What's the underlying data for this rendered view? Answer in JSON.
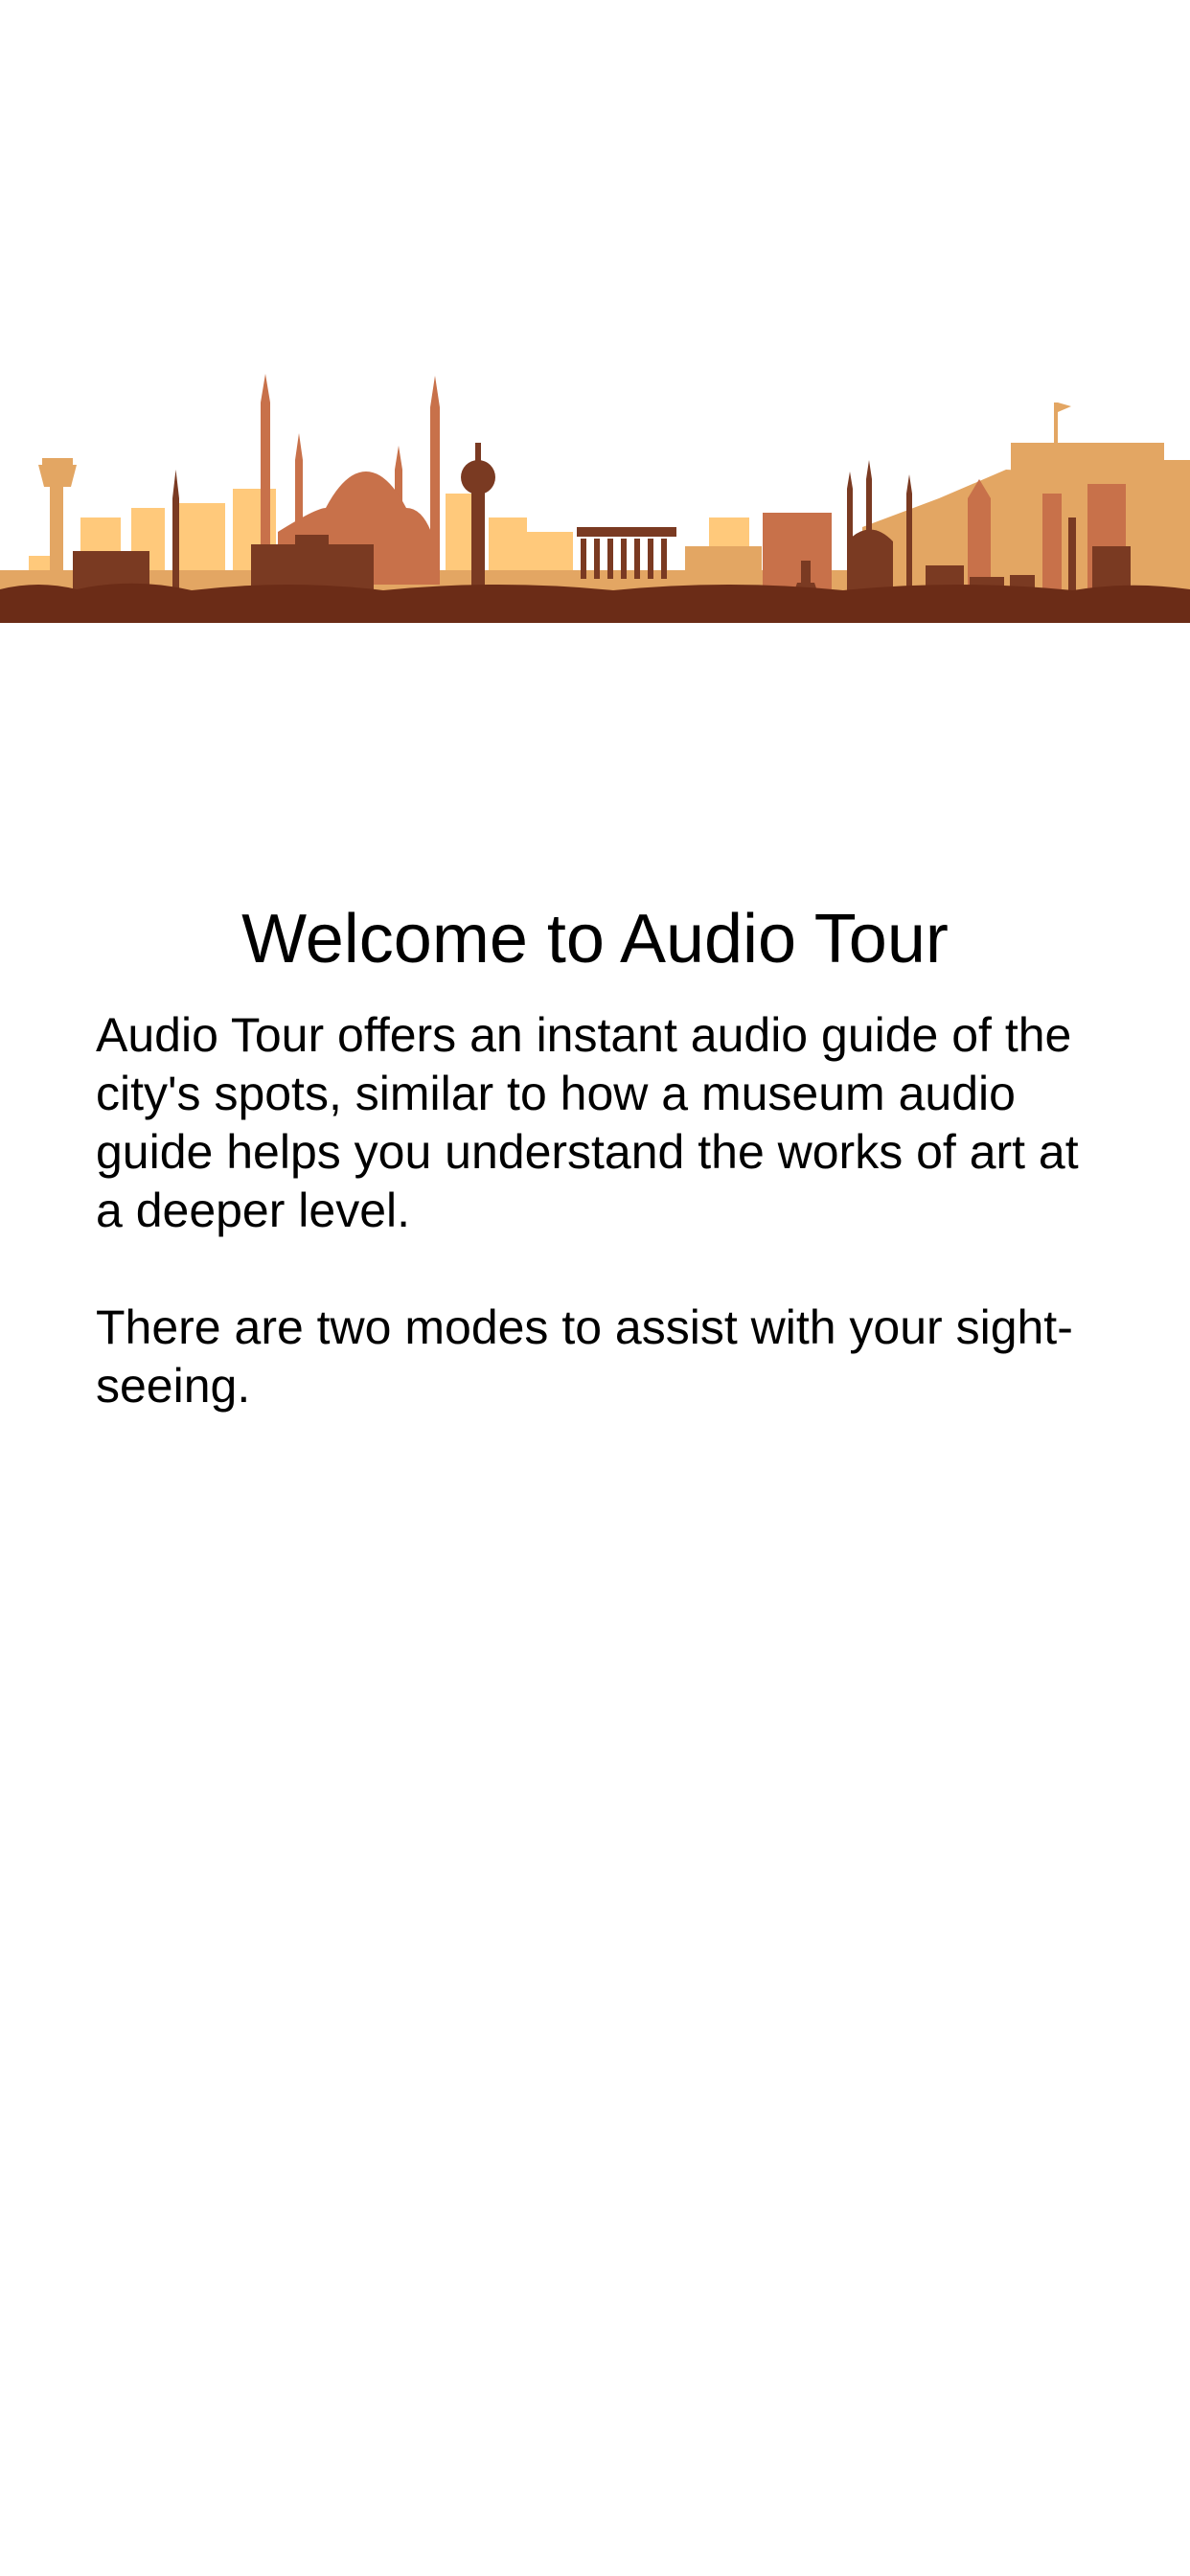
{
  "illustration": {
    "name": "city-skyline-illustration",
    "colors": {
      "light": "#FFC97B",
      "mid": "#E3A663",
      "terracotta": "#C8714A",
      "dark": "#7A3A22",
      "ground": "#6B2C17"
    }
  },
  "welcome": {
    "title": "Welcome to Audio Tour",
    "paragraph1": "Audio Tour offers an instant audio guide of the city's spots, similar to how a museum audio guide helps you understand the works of art at a deeper level.",
    "paragraph2": "There are two modes to assist with your sight-seeing."
  }
}
